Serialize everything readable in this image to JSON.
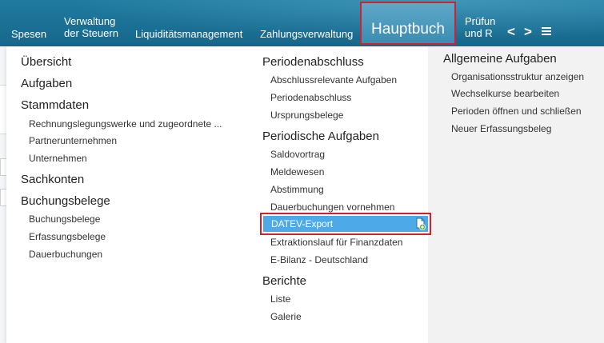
{
  "topnav": {
    "items": [
      {
        "lines": [
          "Spesen"
        ]
      },
      {
        "lines": [
          "Verwaltung",
          "der Steuern"
        ]
      },
      {
        "lines": [
          "Liquiditätsmanagement"
        ]
      },
      {
        "lines": [
          "Zahlungsverwaltung"
        ]
      }
    ],
    "active": "Hauptbuch",
    "truncated_lines": [
      "Prüfun",
      "und R"
    ],
    "prev_symbol": "<",
    "next_symbol": ">"
  },
  "menu": {
    "col1": {
      "ubersicht": "Übersicht",
      "aufgaben": "Aufgaben",
      "stammdaten": "Stammdaten",
      "stammdaten_items": [
        "Rechnungslegungswerke und zugeordnete ...",
        "Partnerunternehmen",
        "Unternehmen"
      ],
      "sachkonten": "Sachkonten",
      "buchungsbelege": "Buchungsbelege",
      "buchungsbelege_items": [
        "Buchungsbelege",
        "Erfassungsbelege",
        "Dauerbuchungen"
      ]
    },
    "col2": {
      "periodenabschluss": "Periodenabschluss",
      "periodenabschluss_items": [
        "Abschlussrelevante Aufgaben",
        "Periodenabschluss",
        "Ursprungsbelege"
      ],
      "periodische": "Periodische Aufgaben",
      "periodische_items": [
        "Saldovortrag",
        "Meldewesen",
        "Abstimmung",
        "Dauerbuchungen vornehmen"
      ],
      "highlighted": "DATEV-Export",
      "periodische_items_after": [
        "Extraktionslauf für Finanzdaten",
        "E-Bilanz - Deutschland"
      ],
      "berichte": "Berichte",
      "berichte_items": [
        "Liste",
        "Galerie"
      ]
    },
    "col3": {
      "title": "Allgemeine Aufgaben",
      "items": [
        "Organisationsstruktur anzeigen",
        "Wechselkurse bearbeiten",
        "Perioden öffnen und schließen",
        "Neuer Erfassungsbeleg"
      ]
    }
  },
  "colors": {
    "accent": "#4da9e8",
    "topbar": "#1a6f94",
    "highlight_border": "#d3202a"
  }
}
